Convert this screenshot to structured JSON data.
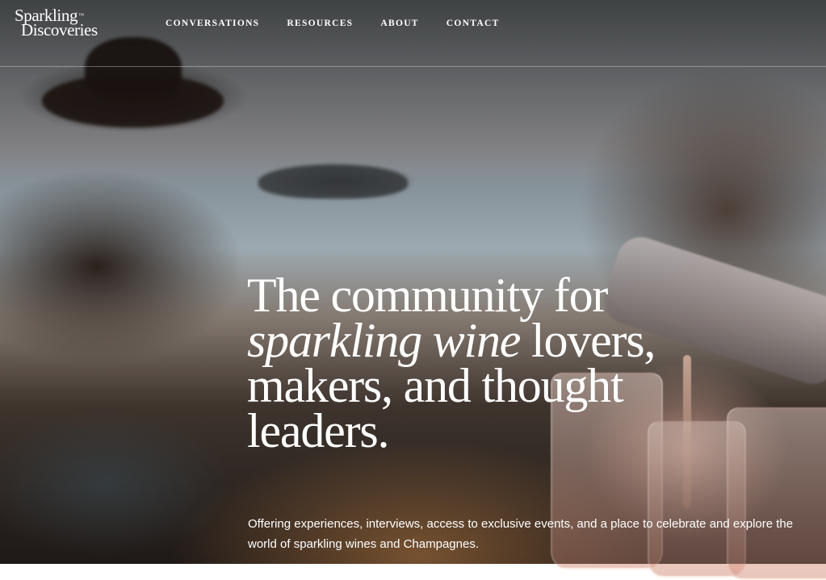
{
  "brand": {
    "line1": "Sparkling",
    "tm": "™",
    "line2": "Discoveries"
  },
  "nav": {
    "items": [
      {
        "label": "CONVERSATIONS"
      },
      {
        "label": "RESOURCES"
      },
      {
        "label": "ABOUT"
      },
      {
        "label": "CONTACT"
      }
    ]
  },
  "hero": {
    "headline_line1": "The community for",
    "headline_italic": "sparkling wine",
    "headline_after_italic": " lovers,",
    "headline_line3": "makers, and thought",
    "headline_line4": "leaders.",
    "subcopy": "Offering experiences, interviews, access to exclusive events, and a place to celebrate and explore the world of sparkling wines and Champagnes."
  }
}
